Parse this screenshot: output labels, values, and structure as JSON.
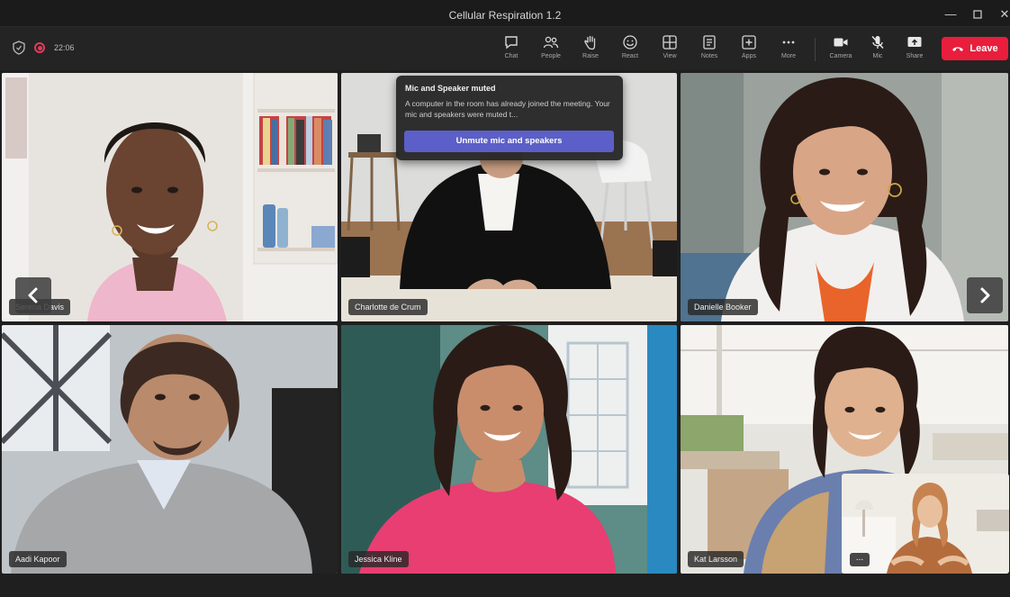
{
  "window": {
    "title": "Cellular Respiration 1.2"
  },
  "status": {
    "timer": "22:06"
  },
  "toolbar": {
    "items": [
      {
        "label": "Chat",
        "icon": "chat-icon"
      },
      {
        "label": "People",
        "icon": "people-icon"
      },
      {
        "label": "Raise",
        "icon": "raise-hand-icon"
      },
      {
        "label": "React",
        "icon": "react-icon"
      },
      {
        "label": "View",
        "icon": "view-icon"
      },
      {
        "label": "Notes",
        "icon": "notes-icon"
      },
      {
        "label": "Apps",
        "icon": "apps-icon"
      },
      {
        "label": "More",
        "icon": "more-icon"
      },
      {
        "label": "Camera",
        "icon": "camera-icon"
      },
      {
        "label": "Mic",
        "icon": "mic-off-icon"
      },
      {
        "label": "Share",
        "icon": "share-icon"
      }
    ],
    "leave_label": "Leave"
  },
  "popup": {
    "title": "Mic and Speaker muted",
    "body": "A computer in the room has already joined the meeting. Your mic and speakers were muted t...",
    "button": "Unmute mic and speakers"
  },
  "participants": [
    {
      "name": "Serena Davis"
    },
    {
      "name": "Charlotte de Crum"
    },
    {
      "name": "Danielle Booker"
    },
    {
      "name": "Aadi Kapoor"
    },
    {
      "name": "Jessica Kline"
    },
    {
      "name": "Kat Larsson"
    }
  ],
  "self_view": {
    "more_label": "..."
  },
  "colors": {
    "leave": "#e81e3c",
    "accent": "#5b5fc7",
    "recording": "#e43a5b"
  }
}
